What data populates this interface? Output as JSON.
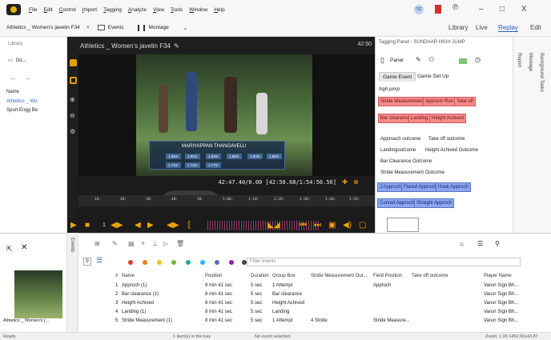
{
  "menu": [
    "File",
    "Edit",
    "Control",
    "Import",
    "Tagging",
    "Analyze",
    "View",
    "Tools",
    "Window",
    "Help"
  ],
  "window_controls": [
    "–",
    "□",
    "X"
  ],
  "avatar_initials": "TC",
  "tabs": {
    "document": "Athletics _ Women's javelin F34",
    "close": "×",
    "events": "Events",
    "montage": "Montage",
    "library": "Library",
    "live": "Live",
    "replay": "Replay",
    "edit": "Edit"
  },
  "library": {
    "header": "Library",
    "folder": "Do...",
    "name_label": "Name",
    "items": [
      "Athletics _ Wo",
      "Sport Engg Be"
    ]
  },
  "video": {
    "title": "Athletics _ Women's javelin F34",
    "duration": "42:50",
    "player_name": "MARIYAPPAN THANGAVELU",
    "results_row1": [
      "1.65m",
      "1.80m",
      "1.83m",
      "1.86m",
      "1.83m",
      "1.86m"
    ],
    "results_row2": [
      "1.71m",
      "1.74m",
      "1.77m"
    ],
    "timecode": "42:47.40/0.00 [42:50.68/1:54:50.56]"
  },
  "timeline": {
    "ticks": [
      "10:",
      "20:",
      "30:",
      "40:",
      "50:",
      "1:00:",
      "1:10:",
      "1:20:",
      "1:30:",
      "1:40:",
      "1:50:"
    ]
  },
  "tagging": {
    "title": "Tagging Panel - SUNDHAR HIGH JUMP",
    "panel_label": "Panel",
    "tab_active": "Game Event",
    "tab_other": "Game Set Up",
    "section": "high jump",
    "red_buttons": [
      "Stride Measurement",
      "Approch Run",
      "Take off",
      "Bar clearance",
      "Landing",
      "Height Achived"
    ],
    "plain_items": [
      "Approach outcome",
      "Take off outcome",
      "Landingoutcome",
      "Height Achived Outcome",
      "Bar Clearance Outcome",
      "Stride Measurement Outcome"
    ],
    "blue_buttons": [
      "J Approch",
      "Flared Approch",
      "Hook Approch",
      "Curved Approch",
      "Straight Approch"
    ],
    "side_labels": [
      "Report",
      "Montage",
      "Background Tasks"
    ]
  },
  "events": {
    "side_label": "Events",
    "filter_placeholder": "Filter events",
    "dot_colors": [
      "#e53935",
      "#e67e22",
      "#f1c40f",
      "#7cb342",
      "#26a69a",
      "#29b6f6",
      "#5c6bc0",
      "#8e24aa",
      "#444444"
    ],
    "columns": [
      "#",
      "Name",
      "Position",
      "Duration",
      "Group Box",
      "Stride Measurement Out...",
      "Field Position",
      "Take off outcome",
      "Player Name"
    ],
    "rows": [
      [
        "1",
        "Approch (1)",
        "8 min 41 sec",
        "5 sec",
        "1 Attempt",
        "",
        "Approch",
        "",
        "Varun Sign Bh..."
      ],
      [
        "2",
        "Bar clearance (1)",
        "8 min 41 sec",
        "5 sec",
        "Bar clearance",
        "",
        "",
        "",
        "Varun Sign Bh..."
      ],
      [
        "3",
        "Height Achived",
        "8 min 41 sec",
        "5 sec",
        "Height Achived",
        "",
        "",
        "",
        "Varun Sign Bh..."
      ],
      [
        "4",
        "Landing (1)",
        "8 min 41 sec",
        "5 sec",
        "Landing",
        "",
        "",
        "",
        "Varun Sign Bh..."
      ],
      [
        "5",
        "Stride Measurement (1)",
        "8 min 41 sec",
        "5 sec",
        "1 Attempt",
        "4 Stride",
        "Stride Measure...",
        "",
        "Varun Sign Bh..."
      ]
    ],
    "thumb_caption": "Athletics _ Women's j..."
  },
  "status": {
    "ready": "Ready",
    "items_in_tray": "1 item(s) in the tray",
    "no_event": "No event selected",
    "zoom": "Zoom: 1.00  1452.00x43.87"
  }
}
